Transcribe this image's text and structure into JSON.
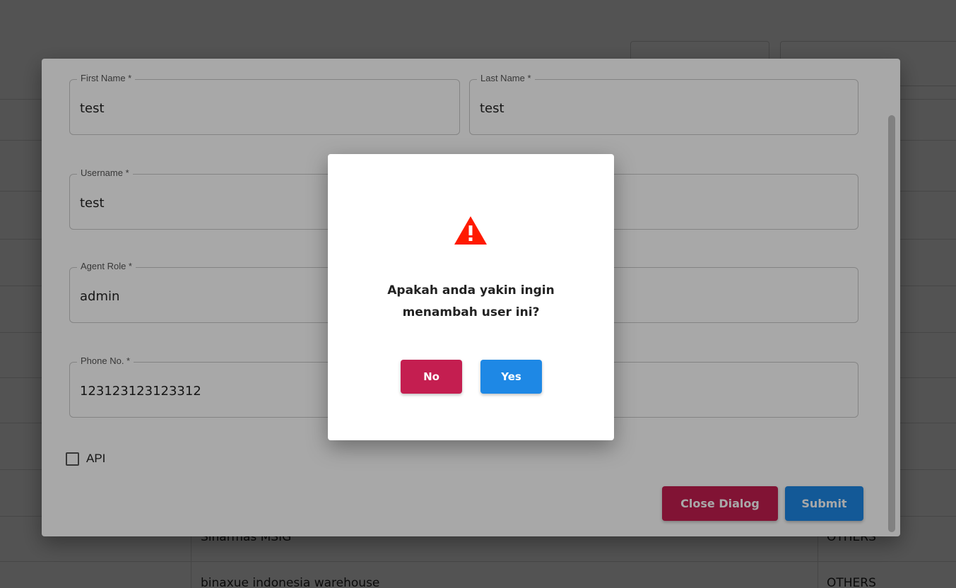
{
  "background": {
    "rows": [
      {
        "name": "Sinarmas MSIG",
        "category": "OTHERS"
      },
      {
        "name": "binaxue indonesia warehouse",
        "category": "OTHERS"
      }
    ]
  },
  "form": {
    "first_name": {
      "label": "First Name *",
      "value": "test"
    },
    "last_name": {
      "label": "Last Name *",
      "value": "test"
    },
    "username": {
      "label": "Username *",
      "value": "test"
    },
    "agent_role": {
      "label": "Agent Role *",
      "value": "admin"
    },
    "phone": {
      "label": "Phone No. *",
      "value": "123123123123312"
    },
    "api_label": "API",
    "close_label": "Close Dialog",
    "submit_label": "Submit"
  },
  "confirm": {
    "icon": "warning-icon",
    "message_line1": "Apakah anda yakin ingin",
    "message_line2": "menambah user ini?",
    "no_label": "No",
    "yes_label": "Yes"
  },
  "colors": {
    "danger": "#c41e50",
    "primary": "#1e88e5",
    "warning": "#ff1a00"
  }
}
